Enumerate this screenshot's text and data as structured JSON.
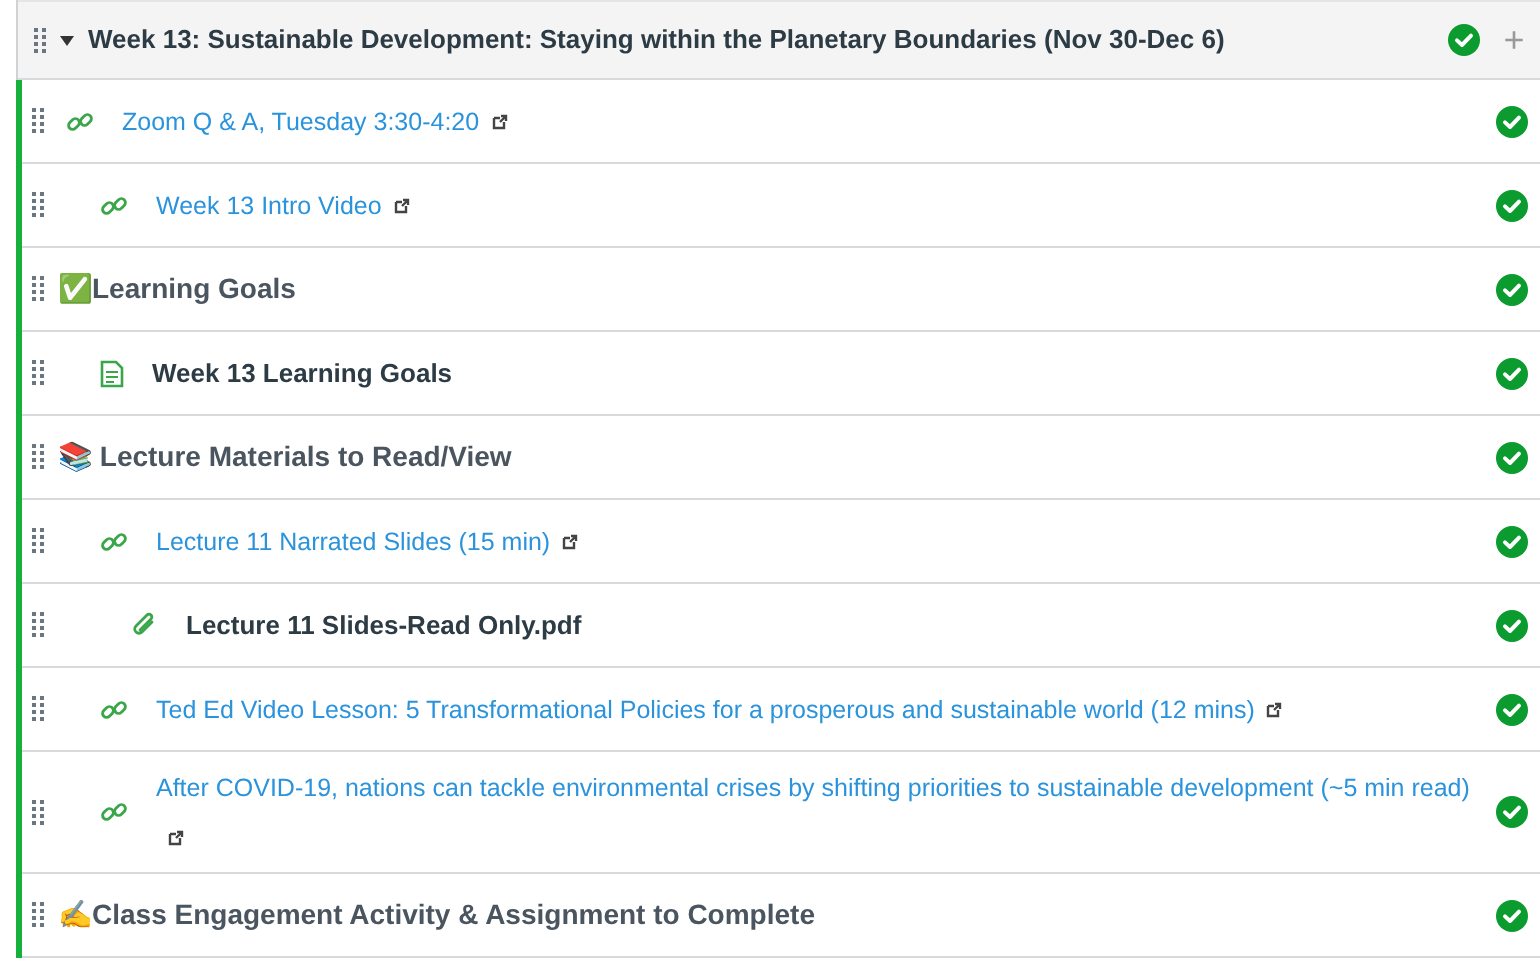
{
  "module": {
    "title": "Week 13: Sustainable Development: Staying within the Planetary Boundaries (Nov 30-Dec 6)",
    "expanded": true,
    "completed": true,
    "add_label": "+"
  },
  "items": [
    {
      "kind": "link",
      "title": "Zoom Q & A, Tuesday 3:30-4:20",
      "completed": true,
      "children": [
        {
          "kind": "link",
          "title": "Week 13 Intro Video",
          "completed": true
        }
      ]
    },
    {
      "kind": "header",
      "title": "✅Learning Goals",
      "completed": true,
      "children": [
        {
          "kind": "page",
          "title": "Week 13 Learning Goals",
          "completed": true
        }
      ]
    },
    {
      "kind": "header",
      "title": "📚 Lecture Materials to Read/View",
      "completed": true,
      "children": [
        {
          "kind": "link",
          "title": "Lecture 11 Narrated Slides (15 min)",
          "completed": true,
          "children": [
            {
              "kind": "file",
              "title": "Lecture 11 Slides-Read Only.pdf",
              "completed": true
            }
          ]
        },
        {
          "kind": "link",
          "title": "Ted Ed Video Lesson: 5 Transformational Policies for a prosperous and sustainable world (12 mins)",
          "completed": true
        },
        {
          "kind": "link",
          "title": "After COVID-19, nations can tackle environmental crises by shifting priorities to sustainable development (~5 min read)",
          "completed": true
        }
      ]
    },
    {
      "kind": "header",
      "title": "✍️Class Engagement Activity & Assignment to Complete",
      "completed": true
    }
  ]
}
